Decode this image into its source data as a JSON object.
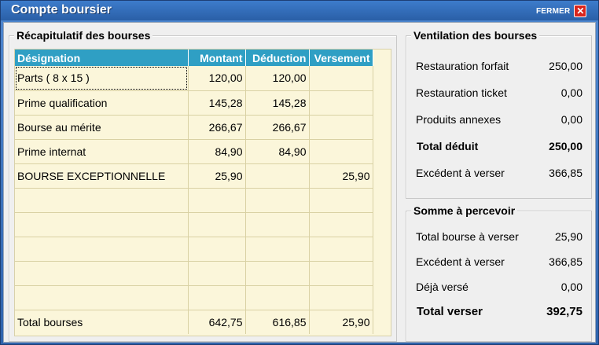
{
  "window": {
    "title": "Compte boursier",
    "close_label": "FERMER",
    "close_icon": "x-icon"
  },
  "recap": {
    "legend": "Récapitulatif des bourses",
    "columns": [
      "Désignation",
      "Montant",
      "Déduction",
      "Versement"
    ],
    "rows": [
      [
        "Parts ( 8 x 15 )",
        "120,00",
        "120,00",
        ""
      ],
      [
        "Prime qualification",
        "145,28",
        "145,28",
        ""
      ],
      [
        "Bourse au mérite",
        "266,67",
        "266,67",
        ""
      ],
      [
        "Prime internat",
        "84,90",
        "84,90",
        ""
      ],
      [
        "BOURSE EXCEPTIONNELLE",
        "25,90",
        "",
        "25,90"
      ],
      [
        "",
        "",
        "",
        ""
      ],
      [
        "",
        "",
        "",
        ""
      ],
      [
        "",
        "",
        "",
        ""
      ],
      [
        "",
        "",
        "",
        ""
      ],
      [
        "",
        "",
        "",
        ""
      ]
    ],
    "total": [
      "Total bourses",
      "642,75",
      "616,85",
      "25,90"
    ]
  },
  "ventilation": {
    "legend": "Ventilation des bourses",
    "items": [
      {
        "label": "Restauration forfait",
        "value": "250,00"
      },
      {
        "label": "Restauration ticket",
        "value": "0,00"
      },
      {
        "label": "Produits annexes",
        "value": "0,00"
      },
      {
        "label": "Total déduit",
        "value": "250,00"
      },
      {
        "label": "Excédent à verser",
        "value": "366,85"
      }
    ]
  },
  "somme": {
    "legend": "Somme à percevoir",
    "items": [
      {
        "label": "Total bourse à verser",
        "value": "25,90"
      },
      {
        "label": "Excédent à verser",
        "value": "366,85"
      },
      {
        "label": "Déjà versé",
        "value": "0,00"
      },
      {
        "label": "Total verser",
        "value": "392,75"
      }
    ]
  },
  "colors": {
    "title_bar": "#2f63ad",
    "grid_header": "#2f9fc4",
    "grid_background": "#fbf6da",
    "close_button": "#d9251d"
  }
}
